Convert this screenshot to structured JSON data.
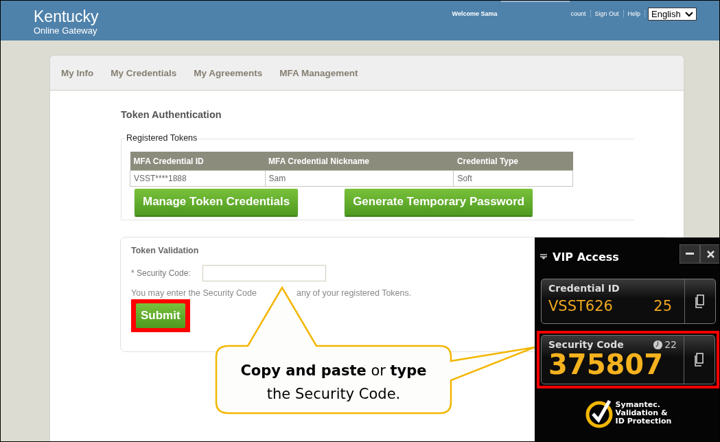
{
  "header": {
    "logo_title": "Kentucky",
    "logo_subtitle": "Online Gateway",
    "welcome": "Welcome Sama",
    "links": [
      "count",
      "Sign Out",
      "Help"
    ],
    "language": "English"
  },
  "tabs": [
    {
      "label": "My Info",
      "selected": false
    },
    {
      "label": "My Credentials",
      "selected": false
    },
    {
      "label": "My Agreements",
      "selected": false
    },
    {
      "label": "MFA Management",
      "selected": false
    }
  ],
  "token_authentication": {
    "title": "Token Authentication",
    "legend": "Registered Tokens",
    "columns": [
      "MFA Credential ID",
      "MFA Credential Nickname",
      "Credential Type"
    ],
    "rows": [
      [
        "VSST****1888",
        "Sam",
        "Soft"
      ]
    ],
    "buttons": [
      "Manage Token Credentials",
      "Generate Temporary Password"
    ]
  },
  "token_validation": {
    "title": "Token Validation",
    "field_label": "* Security Code:",
    "hint_parts": [
      "You may enter the Security Code",
      "any of your registered Tokens."
    ],
    "submit": "Submit"
  },
  "callout": {
    "text": "**Copy and paste** or **type** the Security Code."
  },
  "vip_access": {
    "title": "VIP Access",
    "credential_label": "Credential ID",
    "credential_id": "VSST626",
    "credential_suffix": "25",
    "security_label": "Security Code",
    "timer": "22",
    "security_code": "375807",
    "logo_lines": [
      "Symantec.",
      "Validation &",
      "ID Protection"
    ]
  }
}
